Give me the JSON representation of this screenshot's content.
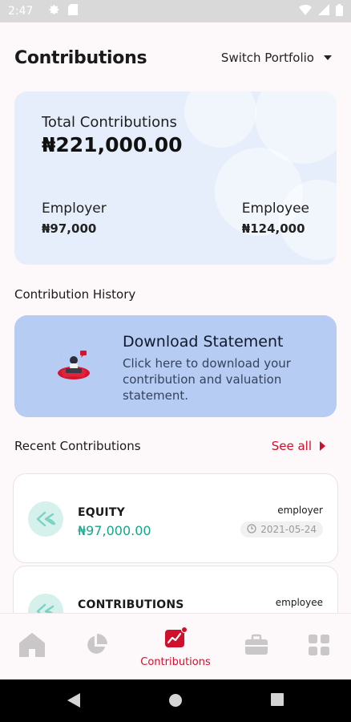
{
  "status_bar": {
    "time": "2:47"
  },
  "header": {
    "title": "Contributions",
    "switch_label": "Switch Portfolio"
  },
  "summary": {
    "total_label": "Total Contributions",
    "total_value": "₦221,000.00",
    "employer_label": "Employer",
    "employer_value": "₦97,000",
    "employee_label": "Employee",
    "employee_value": "₦124,000"
  },
  "history": {
    "section_title": "Contribution History"
  },
  "download": {
    "title": "Download Statement",
    "description": "Click here to download  your contribution and valuation statement."
  },
  "recent": {
    "title": "Recent Contributions",
    "see_all": "See all",
    "items": [
      {
        "name": "EQUITY",
        "amount": "₦97,000.00",
        "type": "employer",
        "date": "2021-05-24"
      },
      {
        "name": "CONTRIBUTIONS",
        "amount": "",
        "type": "employee",
        "date": ""
      }
    ]
  },
  "nav": {
    "active_label": "Contributions"
  },
  "colors": {
    "accent": "#d0102a",
    "teal": "#16a58a",
    "card_blue": "#e6eefb",
    "download_blue": "#b7ccf2"
  },
  "icons": [
    "settings-icon",
    "sd-card-icon",
    "wifi-icon",
    "signal-icon",
    "battery-icon",
    "home-icon",
    "pie-chart-icon",
    "trend-chart-icon",
    "briefcase-icon",
    "grid-icon",
    "back-icon",
    "home-circle-icon",
    "recents-icon"
  ]
}
